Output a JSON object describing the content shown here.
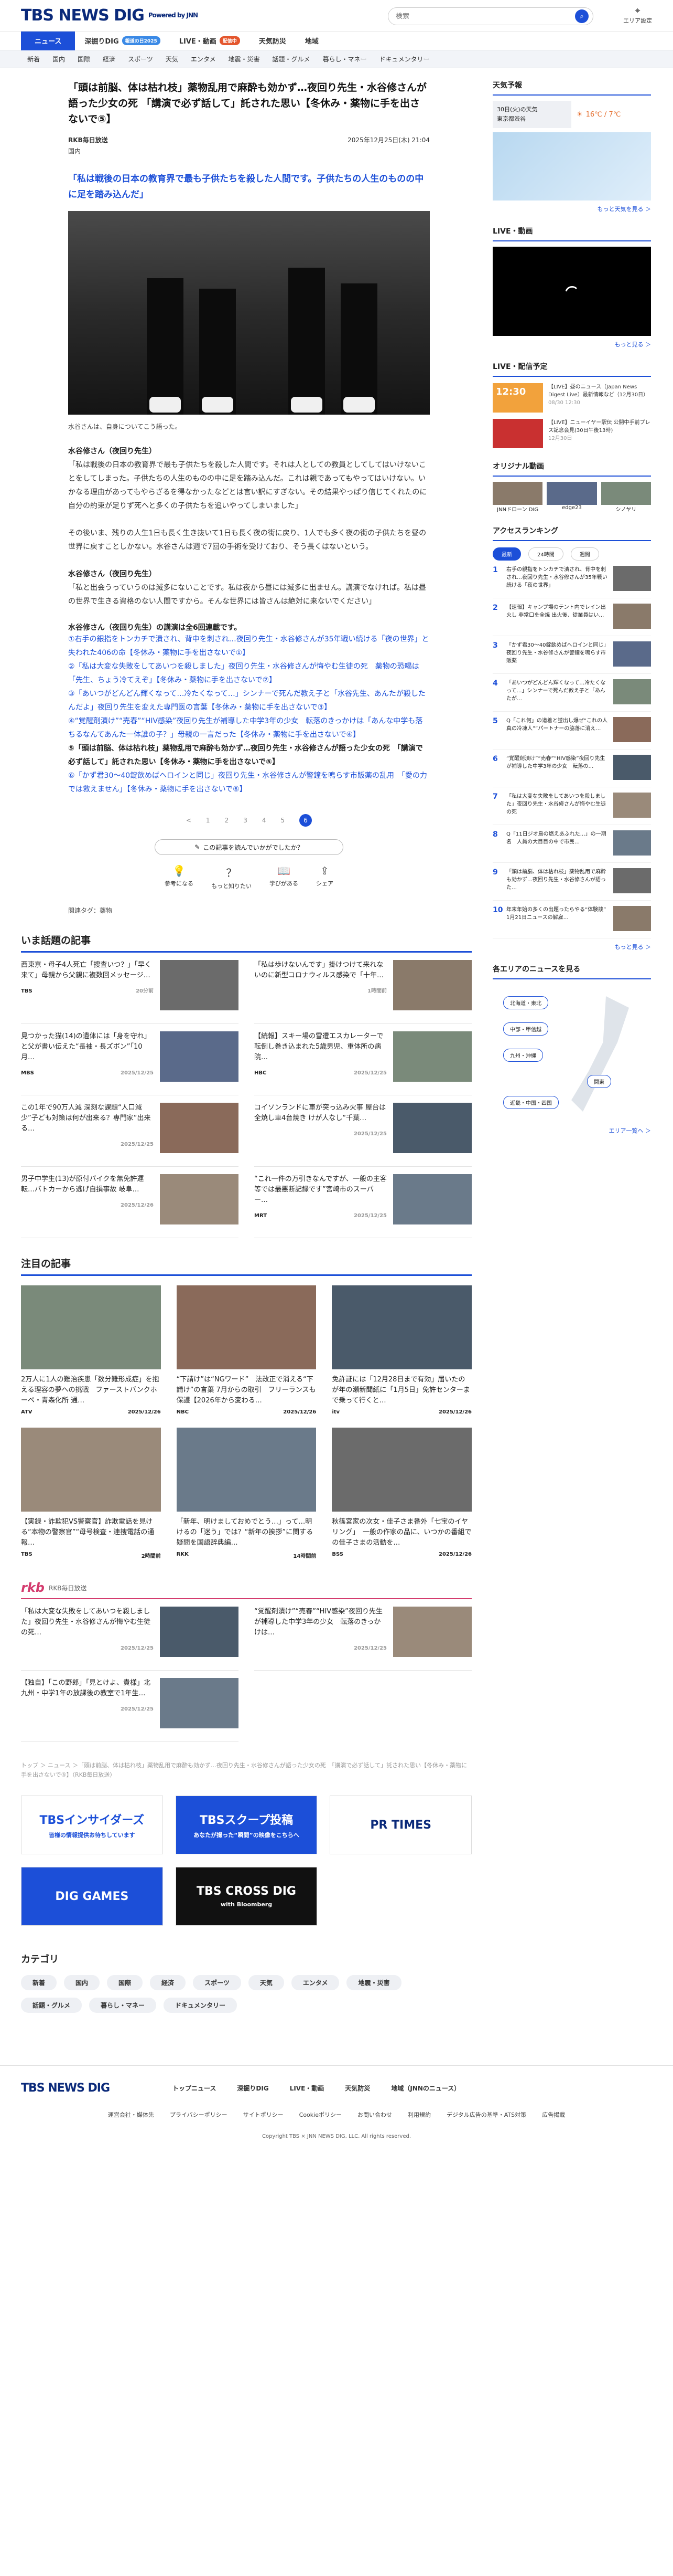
{
  "header": {
    "logo": "TBS NEWS DIG",
    "powered": "Powered by JNN",
    "search_placeholder": "検索",
    "area_label": "エリア設定"
  },
  "nav1": [
    {
      "label": "ニュース",
      "active": true
    },
    {
      "label": "深掘りDIG",
      "badge": "報道の日2025",
      "badge_color": "#3b8ae6"
    },
    {
      "label": "LIVE・動画",
      "badge": "配信中",
      "badge_color": "#e4572e"
    },
    {
      "label": "天気防災"
    },
    {
      "label": "地域"
    }
  ],
  "nav2": [
    "新着",
    "国内",
    "国際",
    "経済",
    "スポーツ",
    "天気",
    "エンタメ",
    "地震・災害",
    "話題・グルメ",
    "暮らし・マネー",
    "ドキュメンタリー"
  ],
  "article": {
    "title": "「頭は前脳、体は枯れ枝」薬物乱用で麻酔も効かず…夜回り先生・水谷修さんが語った少女の死 「講演で必ず話して」託された思い【冬休み・薬物に手を出さないで⑤】",
    "source": "RKB毎日放送",
    "date": "2025年12月25日(木) 21:04",
    "category": "国内",
    "lead": "「私は戦後の日本の教育界で最も子供たちを殺した人間です。子供たちの人生のものの中に足を踏み込んだ」",
    "caption": "水谷さんは、自身についてこう語った。",
    "paragraphs": [
      {
        "sub": "水谷修さん（夜回り先生）",
        "text": "「私は戦後の日本の教育界で最も子供たちを殺した人間です。それは人としての教員としてしてはいけないことをしてしまった。子供たちの人生のものの中に足を踏み込んだ。これは親であってもやってはいけない。いかなる理由があってもやらざるを得なかったなどとは言い訳にすぎない。その結果やっぱり信じてくれたのに自分の約束が足りず死へと多くの子供たちを追いやってしまいました」"
      },
      {
        "sub": "",
        "text": "その後いま、残りの人生1日も長く生き抜いて1日も長く夜の街に戻り、1人でも多く夜の街の子供たちを昼の世界に戻すことしかない。水谷さんは週で7回の手術を受けており、そう長くはないという。"
      },
      {
        "sub": "水谷修さん（夜回り先生）",
        "text": "「私と出会うっていうのは滅多にないことです。私は夜から昼には滅多に出ません。講演でなければ。私は昼の世界で生きる資格のない人間ですから。そんな世界には皆さんは絶対に来ないでください」"
      }
    ],
    "links_title": "水谷修さん（夜回り先生）の講演は全6回連載です。",
    "links": [
      {
        "text": "①右手の銀指をトンカチで潰され、背中を刺され…夜回り先生・水谷修さんが35年戦い続ける「夜の世界」と失われた406の命【冬休み・薬物に手を出さないで①】",
        "bold": false
      },
      {
        "text": "②「私は大変な失敗をしてあいつを殺しました」夜回り先生・水谷修さんが悔やむ生徒の死　薬物の恐喝は「先生、ちょう冷てえぞ」【冬休み・薬物に手を出さないで②】",
        "bold": false
      },
      {
        "text": "③「あいつがどんどん輝くなって…冷たくなって…」シンナーで死んだ教え子と「水谷先生、あんたが殺したんだよ」夜回り先生を変えた専門医の言葉【冬休み・薬物に手を出さないで③】",
        "bold": false
      },
      {
        "text": "④“覚醒剤漬け”“売春”“HIV感染”夜回り先生が補導した中学3年の少女　転落のきっかけは「あんな中学も落ちるなんてあんた一体誰の子？」母親の一言だった【冬休み・薬物に手を出さないで④】",
        "bold": false
      },
      {
        "text": "⑤「頭は前脳、体は枯れ枝」薬物乱用で麻酔も効かず…夜回り先生・水谷修さんが語った少女の死　「講演で必ず話して」託された思い【冬休み・薬物に手を出さないで⑤】",
        "bold": true
      },
      {
        "text": "⑥「かず君30〜40錠飲めばヘロインと同じ」夜回り先生・水谷修さんが警鐘を鳴らす市販薬の乱用　「愛の力では救えません」【冬休み・薬物に手を出さないで⑥】",
        "bold": false
      }
    ],
    "pager": [
      "<",
      "1",
      "2",
      "3",
      "4",
      "5",
      "6"
    ],
    "pager_current": "6",
    "help_label": "この記事を読んでいかがでしたか？",
    "reacts": [
      {
        "icon": "💡",
        "label": "参考になる"
      },
      {
        "icon": "？",
        "label": "もっと知りたい"
      },
      {
        "icon": "📖",
        "label": "学びがある"
      },
      {
        "icon": "⇪",
        "label": "シェア"
      }
    ],
    "tags": "関連タグ：薬物"
  },
  "trending": {
    "title": "いま話題の記事",
    "items": [
      {
        "text": "西東京・母子4人死亡「捜査いつ？」「早く来て」母親から父親に複数回メッセージ…",
        "brand": "TBS",
        "date": "20分前"
      },
      {
        "text": "「私は歩けないんです」掛けつけて来れないのに新型コロナウィルス感染で「十年…",
        "brand": "",
        "date": "1時間前"
      },
      {
        "text": "見つかった猫(14)の遺体には「身を守れ」と父が書い伝えた“長袖・長ズボン”「10月…",
        "brand": "MBS",
        "date": "2025/12/25"
      },
      {
        "text": "【続報】スキー場の雪遭エスカレーターで転倒し巻き込まれた5歳男児、重体所の病院…",
        "brand": "HBC",
        "date": "2025/12/25"
      },
      {
        "text": "この1年で90万人減 深刻な課題“人口減少”子ども対策は何が出来る？専門家“出来る…",
        "brand": "",
        "date": "2025/12/25"
      },
      {
        "text": "コイソンランドに車が突っ込み火事 屋台は全焼し車4台焼き けが人なし“千葉…",
        "brand": "",
        "date": "2025/12/25"
      },
      {
        "text": "男子中学生(13)が原付バイクを無免許運転…バトカーから逃げ自損事故 岐阜…",
        "brand": "",
        "date": "2025/12/26"
      },
      {
        "text": "“これ一件の万引きなんですが、一般の主客等では最悪断記録です”宮崎市のスーパー…",
        "brand": "MRT",
        "date": "2025/12/25"
      }
    ]
  },
  "featured": {
    "title": "注目の記事",
    "items": [
      {
        "text": "2万人に1人の難治疾患「数分難形成症」を抱える理容の夢への挑戦　ファーストバンクホーペ・青森化所 通…",
        "brand": "ATV",
        "date": "2025/12/26"
      },
      {
        "text": "“下請け”は“NGワード”　法改正で消える“下請け”の言葉 7月からの取引　フリーランスも保護【2026年から変わる…",
        "brand": "NBC",
        "date": "2025/12/26"
      },
      {
        "text": "免許証には「12月28日まで有効」届いたのが年の瀬新聞紙に「1月5日」免許センターまで乗って行くと…",
        "brand": "itv",
        "date": "2025/12/26"
      },
      {
        "text": "【実録・詐欺犯VS警察官】詐欺電話を見ける“本物の警察官”“母号検査・連捜電話の通報…",
        "brand": "TBS",
        "date": "2時間前"
      },
      {
        "text": "「新年、明けましておめでとう…」って…明けるの「迷う」では？“新年の挨拶”に関する疑問を国語辞典編…",
        "brand": "RKK",
        "date": "14時間前"
      },
      {
        "text": "秋篠宮家の次女・佳子さま番外「七宝のイヤリング」　一般の作家の品に、いつかの番組での佳子さまの活動を…",
        "brand": "BSS",
        "date": "2025/12/26"
      }
    ]
  },
  "rkb": {
    "logo": "rkb",
    "name": "RKB毎日放送",
    "items": [
      {
        "text": "「私は大変な失敗をしてあいつを殺しました」夜回り先生・水谷修さんが悔やむ生徒の死…",
        "date": "2025/12/25"
      },
      {
        "text": "“覚醒剤漬け”“売春”“HIV感染”夜回り先生が補導した中学3年の少女　転落のきっかけは…",
        "date": "2025/12/25"
      },
      {
        "text": "【独自】「この野郎」「見とけよ、貴様」北九州・中学1年の放課後の教室で1年生…",
        "date": "2025/12/25"
      }
    ]
  },
  "breadcrumb": "トップ ＞ ニュース ＞「頭は前脳、体は枯れ枝」薬物乱用で麻酔も効かず…夜回り先生・水谷修さんが語った少女の死　「講演で必ず話して」託された思い【冬休み・薬物に手を出さないで⑤】（RKB毎日放送）",
  "banners": [
    {
      "label": "TBSインサイダーズ",
      "sub": "皆様の情報提供お待ちしています",
      "bg": "#ffffff",
      "color": "#1c4fd8"
    },
    {
      "label": "TBSスクープ投稿",
      "sub": "あなたが撮った“瞬間”の映像をこちらへ",
      "bg": "#1c4fd8",
      "color": "#ffffff"
    },
    {
      "label": "PR TIMES",
      "sub": "",
      "bg": "#ffffff",
      "color": "#0b2a7a"
    },
    {
      "label": "DIG GAMES",
      "sub": "",
      "bg": "#1c4fd8",
      "color": "#ffffff"
    },
    {
      "label": "TBS CROSS DIG",
      "sub": "with Bloomberg",
      "bg": "#111111",
      "color": "#ffffff"
    }
  ],
  "categories": {
    "title": "カテゴリ",
    "items": [
      "新着",
      "国内",
      "国際",
      "経済",
      "スポーツ",
      "天気",
      "エンタメ",
      "地震・災害",
      "話題・グルメ",
      "暮らし・マネー",
      "ドキュメンタリー"
    ]
  },
  "footer": {
    "logo": "TBS NEWS DIG",
    "links": [
      "トップニュース",
      "深掘りDIG",
      "LIVE・動画",
      "天気防災",
      "地域（JNNのニュース）"
    ],
    "links2": [
      "運営会社・媒体先",
      "プライバシーポリシー",
      "サイトポリシー",
      "Cookieポリシー",
      "お問い合わせ",
      "利用規約",
      "デジタル広告の基準・ATS対策",
      "広告掲載"
    ],
    "copyright": "Copyright TBS × JNN NEWS DIG, LLC. All rights reserved."
  },
  "sidebar": {
    "weather_title": "天気予報",
    "weather_loc": "30日(火)の天気",
    "weather_area": "東京都渋谷",
    "weather_temp": "16℃ / 7℃",
    "weather_more": "もっと天気を見る ＞",
    "live_title": "LIVE・動画",
    "live_more": "もっと見る ＞",
    "sched_title": "LIVE・配信予定",
    "sched": [
      {
        "time": "12:30",
        "text": "【LIVE】昼のニュース（Japan News Digest Live）最新情報など（12月30日）",
        "date": "08/30 12:30"
      },
      {
        "time": "",
        "text": "【LIVE】ニューイヤー駅伝 公開中手前プレス記念会見(30日午後13時)",
        "date": "12月30日"
      }
    ],
    "orig_title": "オリジナル動画",
    "orig": [
      "JNNドローン DIG",
      "edge23",
      "シノヤリ"
    ],
    "rank_title": "アクセスランキング",
    "rank_tabs": [
      "最新",
      "24時間",
      "週間"
    ],
    "ranks": [
      {
        "n": "1",
        "t": "右手の親指をトンカチで潰され、背中を刺され…夜回り先生・水谷修さんが35年戦い続ける「夜の世界」"
      },
      {
        "n": "2",
        "t": "【速報】キャンプ場のテント内でレイン出火し 非常口を全焼 出火後、従業員はい…"
      },
      {
        "n": "3",
        "t": "「かず君30〜40錠飲めばヘロインと同じ」夜回り先生・水谷修さんが警鐘を鳴らす市販薬"
      },
      {
        "n": "4",
        "t": "「あいつがどんどん輝くなって…冷たくなって…」シンナーで死んだ教え子と「あんたが…"
      },
      {
        "n": "5",
        "t": "Q「これ何」の道着と蛍出し爆ぜ“これの人真の冷凍人”“パートナーの脇落に消え…"
      },
      {
        "n": "6",
        "t": "“覚醒剤漬け”“売春”“HIV感染”夜回り先生が補導した中学3年の少女　転落の…"
      },
      {
        "n": "7",
        "t": "「私は大変な失敗をしてあいつを殺しました」夜回り先生・水谷修さんが悔やむ生徒の死"
      },
      {
        "n": "8",
        "t": "Q「11日ジオ鳥の燃えあふれた…」の一期名　人員の大目目の中で市民…"
      },
      {
        "n": "9",
        "t": "「頭は前脳、体は枯れ枝」薬物乱用で麻酔も効かず…夜回り先生・水谷修さんが語った…"
      },
      {
        "n": "10",
        "t": "年末年始の多くの出題ったらやる“体験談”　1月21日ニュースの解雇…"
      }
    ],
    "rank_more": "もっと見る ＞",
    "area_title": "各エリアのニュースを見る",
    "areas": [
      "北海道・東北",
      "中部・甲信越",
      "九州・沖縄",
      "関東",
      "近畿・中国・四国"
    ],
    "area_more": "エリア一覧へ ＞"
  }
}
